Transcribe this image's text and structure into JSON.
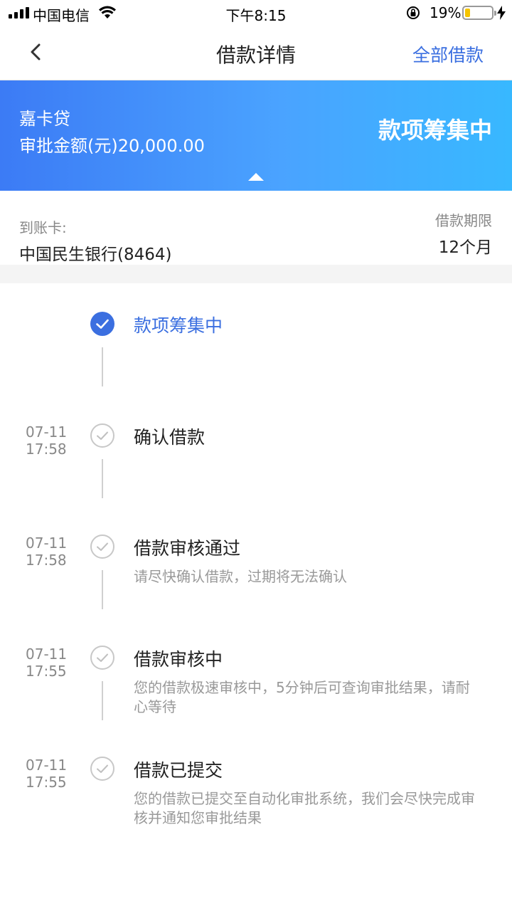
{
  "status_bar": {
    "carrier": "中国电信",
    "time": "下午8:15",
    "battery_percent": "19%",
    "battery_level": 0.19
  },
  "nav": {
    "title": "借款详情",
    "all_loans_label": "全部借款"
  },
  "banner": {
    "product": "嘉卡贷",
    "amount": "审批金额(元)20,000.00",
    "status": "款项筹集中"
  },
  "info": {
    "card_label": "到账卡:",
    "card_value": "中国民生银行(8464)",
    "term_label": "借款期限",
    "term_value": "12个月"
  },
  "timeline": [
    {
      "date": "",
      "time": "",
      "title": "款项筹集中",
      "desc": "",
      "active": true
    },
    {
      "date": "07-11",
      "time": "17:58",
      "title": "确认借款",
      "desc": "",
      "active": false
    },
    {
      "date": "07-11",
      "time": "17:58",
      "title": "借款审核通过",
      "desc": "请尽快确认借款，过期将无法确认",
      "active": false
    },
    {
      "date": "07-11",
      "time": "17:55",
      "title": "借款审核中",
      "desc": "您的借款极速审核中，5分钟后可查询审批结果，请耐心等待",
      "active": false
    },
    {
      "date": "07-11",
      "time": "17:55",
      "title": "借款已提交",
      "desc": "您的借款已提交至自动化审批系统，我们会尽快完成审核并通知您审批结果",
      "active": false
    }
  ],
  "colors": {
    "accent": "#3b6fe0",
    "banner_start": "#3c7bf5",
    "banner_end": "#38b8ff",
    "battery": "#f5c400"
  }
}
